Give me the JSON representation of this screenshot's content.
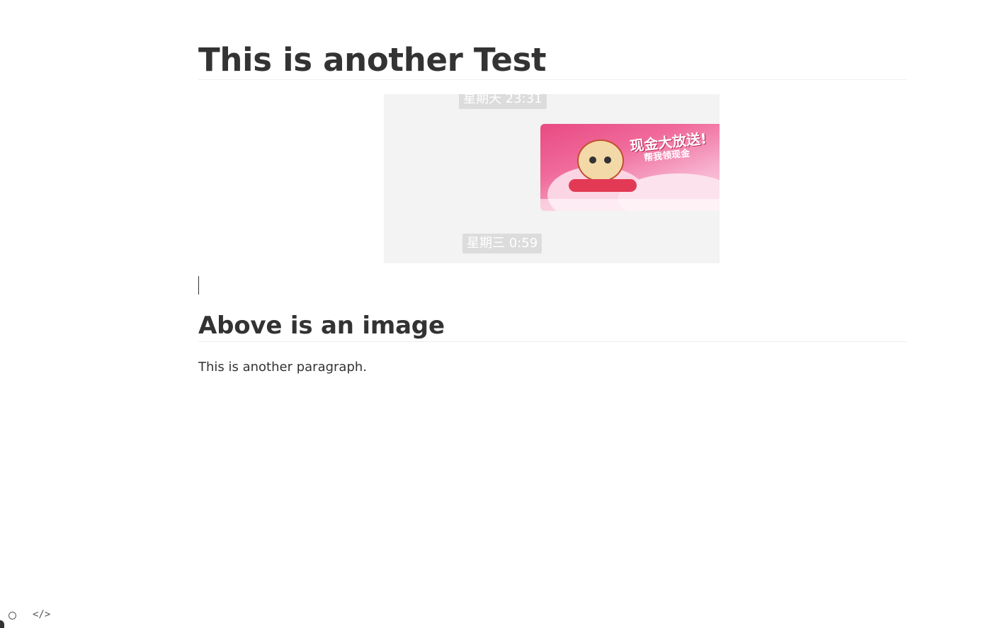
{
  "document": {
    "title": "This is another Test",
    "image": {
      "timestamp_top": "星期天 23:31",
      "timestamp_bottom": "星期三 0:59",
      "card_headline": "现金大放送!",
      "card_subline": "帮我领现金"
    },
    "heading2": "Above is an image",
    "paragraph": "This is another paragraph."
  },
  "statusbar": {
    "sidebar_toggle_icon": "circle-icon",
    "source_mode_icon": "code-icon",
    "source_mode_label": "</>"
  }
}
